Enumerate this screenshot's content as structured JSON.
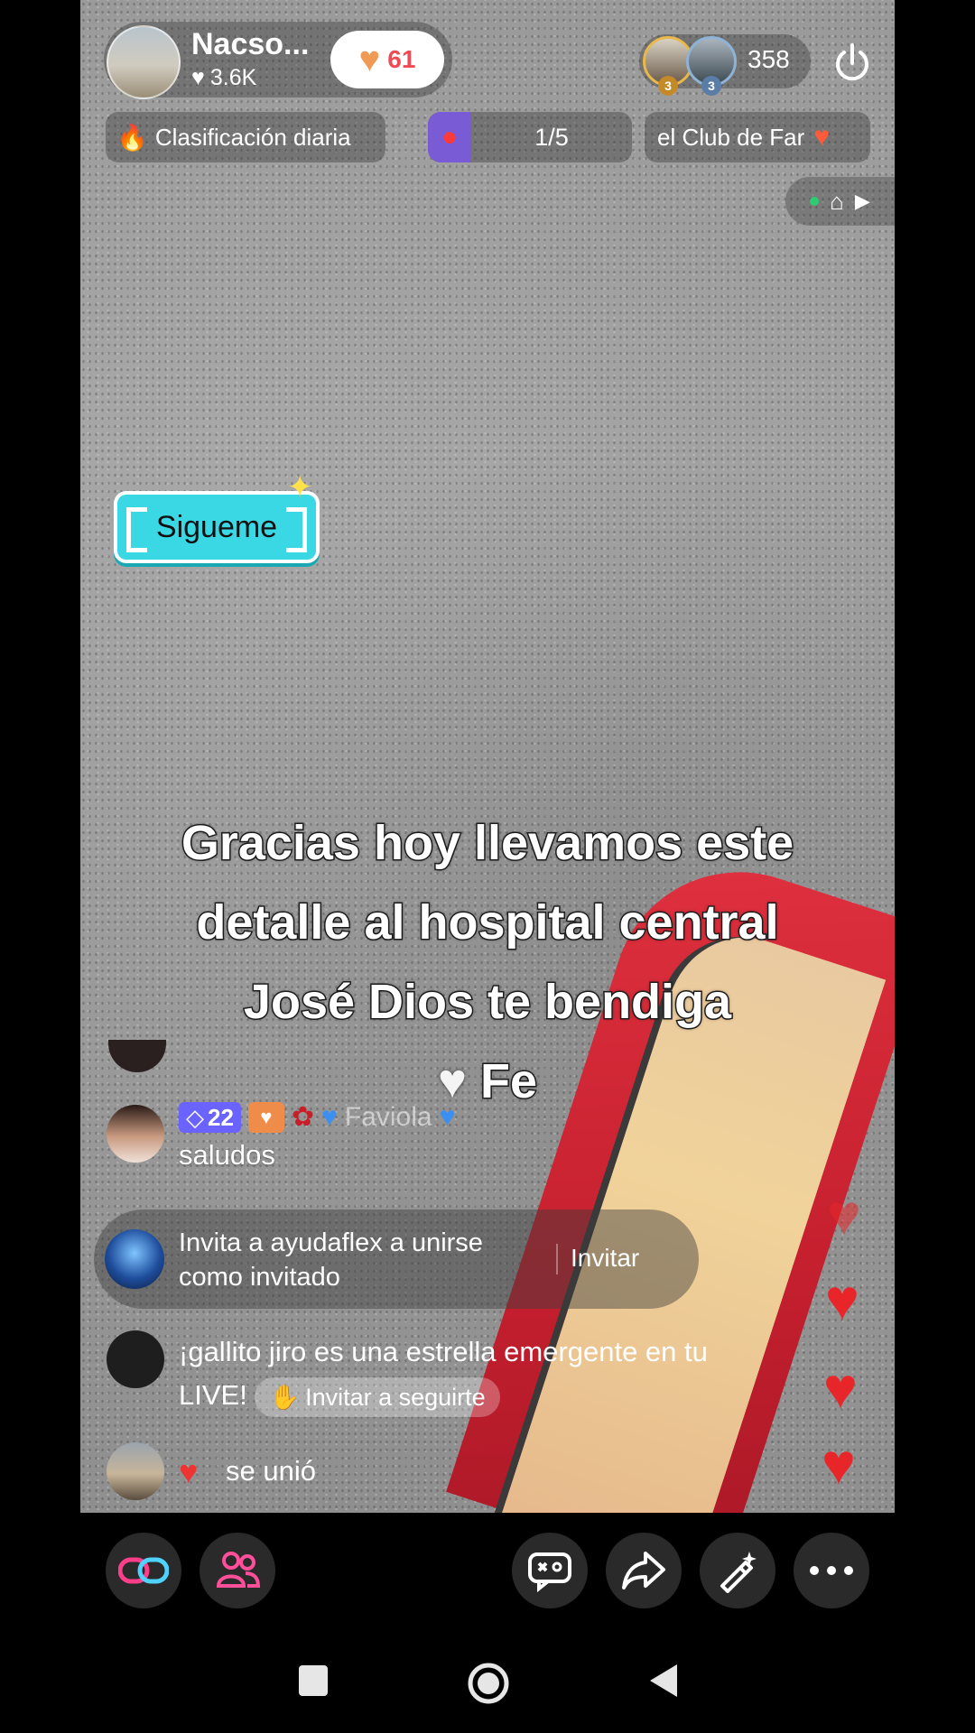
{
  "host": {
    "name": "Nacso...",
    "likes": "3.6K",
    "like_button_count": "61"
  },
  "viewers": {
    "count": "358",
    "top_ranks": [
      "3",
      "3"
    ]
  },
  "chips": {
    "ranking": "Clasificación diaria",
    "goal": "1/5",
    "club": "el Club de Far"
  },
  "sticker": {
    "label": "Sigueme"
  },
  "caption": {
    "lines": [
      "Gracias hoy llevamos este",
      "detalle al hospital central",
      "José Dios te bendiga",
      "Fe"
    ]
  },
  "chat": {
    "message_1": {
      "level": "22",
      "name": "Faviola",
      "text": "saludos"
    },
    "invite": {
      "text_line1": "Invita a ayudaflex a unirse",
      "text_line2": "como invitado",
      "button": "Invitar"
    },
    "emerging": {
      "text_line1": "¡gallito jiro es una estrella emergente en tu",
      "text_line2": "LIVE!",
      "button": "Invitar a seguirte"
    },
    "joined": {
      "text": "se unió"
    }
  },
  "colors": {
    "accent_heart": "#f04a55",
    "sticker_bg": "#3ad8e4",
    "level_badge": "#6b63ff",
    "floating_heart": "#e8262a"
  },
  "icons": {
    "like": "heart-icon",
    "power": "power-icon",
    "ranking": "flame-icon",
    "goal": "goal-icon",
    "club": "club-icon",
    "mini_camera": "camera-icon",
    "actions": [
      "link-icon",
      "guests-icon",
      "gamepad-icon",
      "share-icon",
      "magic-wand-icon",
      "more-icon"
    ],
    "nav": [
      "recents-icon",
      "home-icon",
      "back-icon"
    ]
  }
}
